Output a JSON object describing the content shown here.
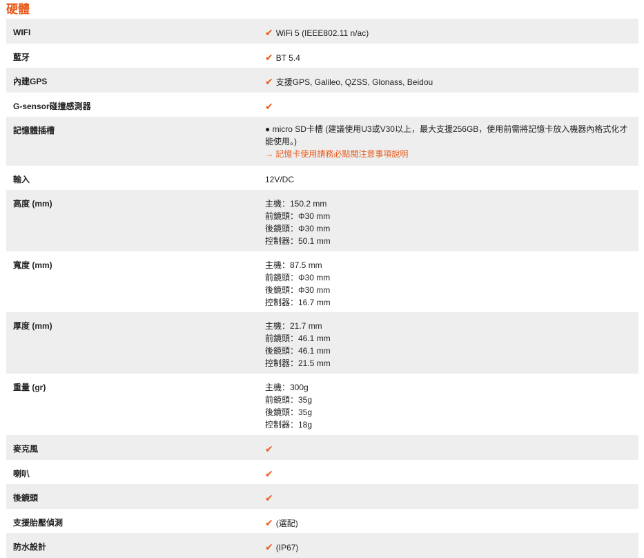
{
  "section": {
    "title": "硬體"
  },
  "icons": {
    "check": "✔"
  },
  "colors": {
    "accent": "#e85a1a",
    "row_alt": "#eeeeee"
  },
  "specs": [
    {
      "label": "WIFI",
      "check": true,
      "text": "WiFi 5 (IEEE802.11 n/ac)"
    },
    {
      "label": "藍牙",
      "check": true,
      "text": "BT 5.4"
    },
    {
      "label": "內建GPS",
      "check": true,
      "text": "支援GPS, Galileo, QZSS, Glonass, Beidou"
    },
    {
      "label": "G-sensor碰撞感測器",
      "check": true,
      "text": ""
    },
    {
      "label": "記憶體插槽",
      "bullet_text": "● micro SD卡槽 (建議使用U3或V30以上，最大支援256GB，使用前需將記憶卡放入機器內格式化才能使用。)",
      "link": "→ 記憶卡使用請務必點閱注意事項說明"
    },
    {
      "label": "輸入",
      "lines": [
        "12V/DC"
      ]
    },
    {
      "label": "高度 (mm)",
      "lines": [
        "主機：150.2 mm",
        "前鏡頭：Φ30 mm",
        "後鏡頭：Φ30 mm",
        "控制器：50.1 mm"
      ]
    },
    {
      "label": "寬度 (mm)",
      "lines": [
        "主機：87.5 mm",
        "前鏡頭：Φ30 mm",
        "後鏡頭：Φ30 mm",
        "控制器：16.7 mm"
      ]
    },
    {
      "label": "厚度 (mm)",
      "lines": [
        "主機：21.7 mm",
        "前鏡頭：46.1 mm",
        "後鏡頭：46.1 mm",
        "控制器：21.5 mm"
      ]
    },
    {
      "label": "重量 (gr)",
      "lines": [
        "主機：300g",
        "前鏡頭：35g",
        "後鏡頭：35g",
        "控制器：18g"
      ]
    },
    {
      "label": "麥克風",
      "check": true,
      "text": ""
    },
    {
      "label": "喇叭",
      "check": true,
      "text": ""
    },
    {
      "label": "後鏡頭",
      "check": true,
      "text": ""
    },
    {
      "label": "支援胎壓偵測",
      "check": true,
      "text": "(選配)"
    },
    {
      "label": "防水設計",
      "check": true,
      "text": "(IP67)"
    }
  ]
}
